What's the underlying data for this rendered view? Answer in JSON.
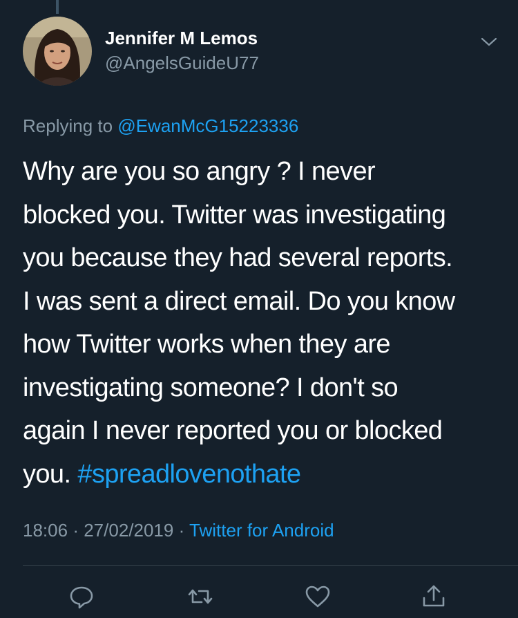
{
  "tweet": {
    "author_name": "Jennifer M Lemos",
    "author_handle": "@AngelsGuideU77",
    "replying_prefix": "Replying to",
    "replying_to": "@EwanMcG15223336",
    "text_lines": [
      "Why are you so angry ? I never",
      "blocked you. Twitter was investigating",
      "you because they had several reports.",
      "I was sent a direct email. Do you know",
      "how Twitter works when they are",
      "investigating someone? I don't so",
      "again I never reported you or blocked"
    ],
    "last_line_text": "you.",
    "hashtag": "#spreadlovenothate",
    "time": "18:06",
    "date": "27/02/2019",
    "separator": "·",
    "source": "Twitter for Android"
  },
  "actions": {
    "icons": [
      "reply-icon",
      "retweet-icon",
      "like-icon",
      "share-icon"
    ]
  },
  "colors": {
    "background": "#15202b",
    "text": "#ffffff",
    "secondary_text": "#8899a6",
    "accent": "#1da1f2",
    "divider": "#38444d"
  }
}
